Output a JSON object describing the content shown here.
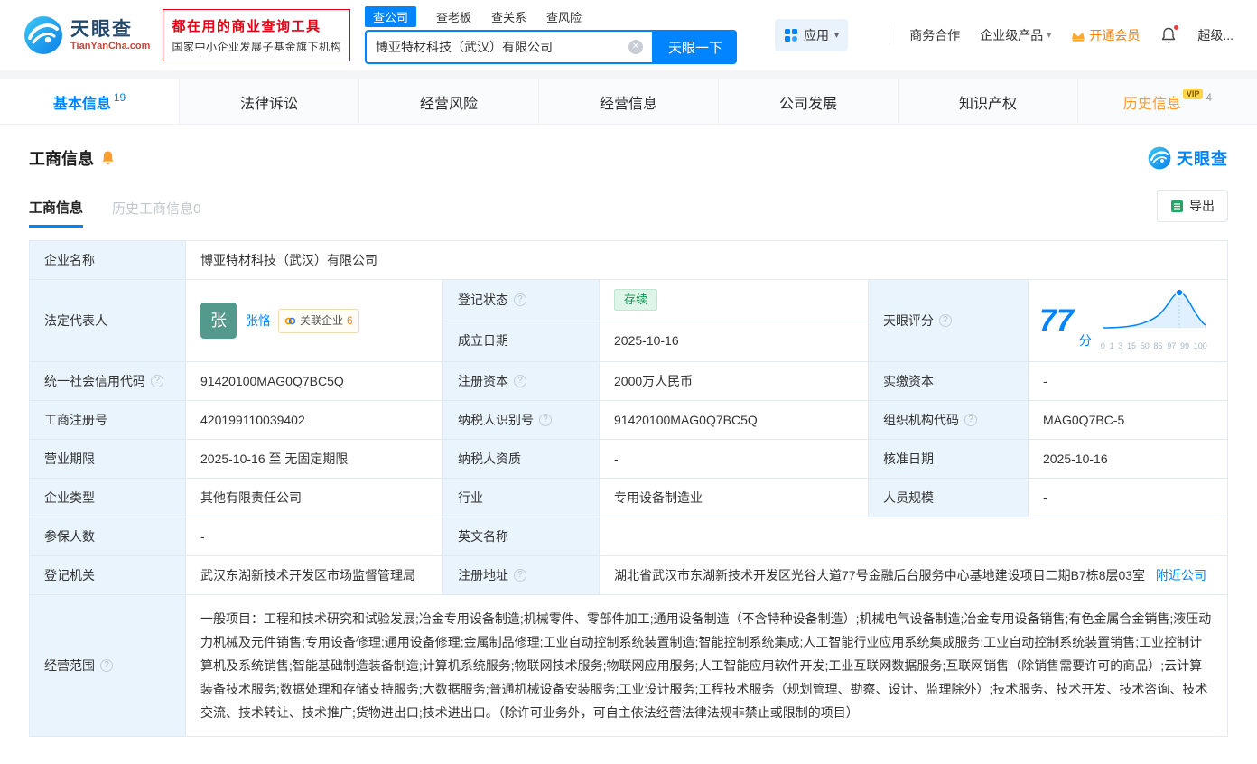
{
  "brand": {
    "name": "天眼查",
    "domain": "TianYanCha.com"
  },
  "header": {
    "promo_line1": "都在用的商业查询工具",
    "promo_line2": "国家中小企业发展子基金旗下机构",
    "search_tabs": [
      {
        "label": "查公司"
      },
      {
        "label": "查老板"
      },
      {
        "label": "查关系"
      },
      {
        "label": "查风险"
      }
    ],
    "search_value": "博亚特材科技（武汉）有限公司",
    "search_button": "天眼一下",
    "apps": "应用",
    "link_cooperation": "商务合作",
    "link_enterprise": "企业级产品",
    "link_vip": "开通会员",
    "link_super": "超级..."
  },
  "nav_tabs": [
    {
      "label": "基本信息",
      "count": "19"
    },
    {
      "label": "法律诉讼"
    },
    {
      "label": "经营风险"
    },
    {
      "label": "经营信息"
    },
    {
      "label": "公司发展"
    },
    {
      "label": "知识产权"
    },
    {
      "label": "历史信息",
      "count": "4",
      "badge": "VIP"
    }
  ],
  "section": {
    "title": "工商信息",
    "subtab_active": "工商信息",
    "subtab_inactive": "历史工商信息0",
    "export": "导出",
    "corner_logo": "天眼查"
  },
  "info": {
    "company_name": {
      "label": "企业名称",
      "value": "博亚特材科技（武汉）有限公司"
    },
    "legal_rep": {
      "label": "法定代表人",
      "avatar": "张",
      "name": "张恪",
      "related": "关联企业",
      "related_count": "6"
    },
    "reg_status": {
      "label": "登记状态",
      "value": "存续"
    },
    "establish_date": {
      "label": "成立日期",
      "value": "2025-10-16"
    },
    "score": {
      "label": "天眼评分",
      "value": "77",
      "unit": "分",
      "axis": [
        "0",
        "1",
        "3",
        "15",
        "50",
        "85",
        "97",
        "99",
        "100"
      ]
    },
    "credit_code": {
      "label": "统一社会信用代码",
      "value": "91420100MAG0Q7BC5Q"
    },
    "reg_capital": {
      "label": "注册资本",
      "value": "2000万人民币"
    },
    "paid_capital": {
      "label": "实缴资本",
      "value": "-"
    },
    "reg_no": {
      "label": "工商注册号",
      "value": "420199110039402"
    },
    "taxpayer_no": {
      "label": "纳税人识别号",
      "value": "91420100MAG0Q7BC5Q"
    },
    "org_code": {
      "label": "组织机构代码",
      "value": "MAG0Q7BC-5"
    },
    "term": {
      "label": "营业期限",
      "value": "2025-10-16 至 无固定期限"
    },
    "taxpayer_quality": {
      "label": "纳税人资质",
      "value": "-"
    },
    "approval_date": {
      "label": "核准日期",
      "value": "2025-10-16"
    },
    "company_type": {
      "label": "企业类型",
      "value": "其他有限责任公司"
    },
    "industry": {
      "label": "行业",
      "value": "专用设备制造业"
    },
    "staff_size": {
      "label": "人员规模",
      "value": "-"
    },
    "insured": {
      "label": "参保人数",
      "value": "-"
    },
    "english_name": {
      "label": "英文名称",
      "value": ""
    },
    "authority": {
      "label": "登记机关",
      "value": "武汉东湖新技术开发区市场监督管理局"
    },
    "address": {
      "label": "注册地址",
      "value": "湖北省武汉市东湖新技术开发区光谷大道77号金融后台服务中心基地建设项目二期B7栋8层03室",
      "link": "附近公司"
    },
    "scope": {
      "label": "经营范围",
      "value": "一般项目：工程和技术研究和试验发展;冶金专用设备制造;机械零件、零部件加工;通用设备制造（不含特种设备制造）;机械电气设备制造;冶金专用设备销售;有色金属合金销售;液压动力机械及元件销售;专用设备修理;通用设备修理;金属制品修理;工业自动控制系统装置制造;智能控制系统集成;人工智能行业应用系统集成服务;工业自动控制系统装置销售;工业控制计算机及系统销售;智能基础制造装备制造;计算机系统服务;物联网技术服务;物联网应用服务;人工智能应用软件开发;工业互联网数据服务;互联网销售（除销售需要许可的商品）;云计算装备技术服务;数据处理和存储支持服务;大数据服务;普通机械设备安装服务;工业设计服务;工程技术服务（规划管理、勘察、设计、监理除外）;技术服务、技术开发、技术咨询、技术交流、技术转让、技术推广;货物进出口;技术进出口。（除许可业务外，可自主依法经营法律法规非禁止或限制的项目）"
    }
  },
  "icons": {
    "caret": "▾",
    "clear": "✕",
    "help": "?"
  },
  "colors": {
    "primary": "#0084ff",
    "orange": "#ff7d00",
    "green_status": "#0b9a54"
  }
}
